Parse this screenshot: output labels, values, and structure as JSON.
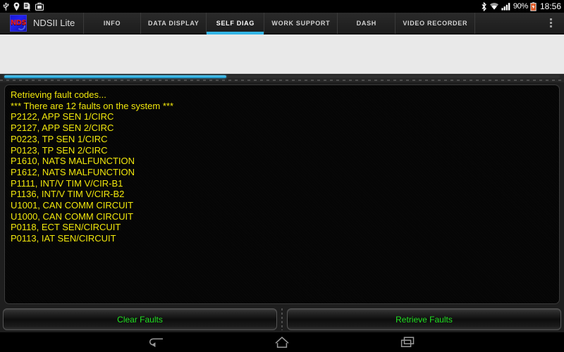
{
  "status_bar": {
    "left_icons": [
      "usb-icon",
      "location-pin-icon",
      "document-error-icon",
      "briefcase-icon"
    ],
    "right_icons": [
      "bluetooth-icon",
      "wifi-icon",
      "signal-icon",
      "battery-icon"
    ],
    "battery_percent": "90%",
    "time": "18:56"
  },
  "action_bar": {
    "app_logo_text": "NDS",
    "app_name": "NDSII Lite",
    "tabs": [
      {
        "label": "INFO",
        "active": false
      },
      {
        "label": "DATA DISPLAY",
        "active": false
      },
      {
        "label": "SELF DIAG",
        "active": true
      },
      {
        "label": "WORK SUPPORT",
        "active": false
      },
      {
        "label": "DASH",
        "active": false
      },
      {
        "label": "VIDEO RECORDER",
        "active": false
      }
    ],
    "overflow_label": "overflow-menu",
    "accent_color": "#33b5e5"
  },
  "progress": {
    "percent": 40,
    "color": "#33b5e5"
  },
  "console": {
    "text_color": "#f2e80c",
    "lines": [
      "Retrieving fault codes...",
      "*** There are 12 faults on the system ***",
      "P2122, APP SEN 1/CIRC",
      "P2127, APP SEN 2/CIRC",
      "P0223, TP SEN 1/CIRC",
      "P0123, TP SEN 2/CIRC",
      "P1610, NATS MALFUNCTION",
      "P1612, NATS MALFUNCTION",
      "P1111, INT/V TIM V/CIR-B1",
      "P1136, INT/V TIM V/CIR-B2",
      "U1001, CAN COMM CIRCUIT",
      "U1000, CAN COMM CIRCUIT",
      "P0118, ECT SEN/CIRCUIT",
      "P0113, IAT SEN/CIRCUIT"
    ]
  },
  "actions": {
    "clear_faults_label": "Clear Faults",
    "retrieve_faults_label": "Retrieve Faults",
    "label_color": "#22e022"
  },
  "nav_bar": {
    "back_label": "back-icon",
    "home_label": "home-icon",
    "recents_label": "recents-icon"
  }
}
